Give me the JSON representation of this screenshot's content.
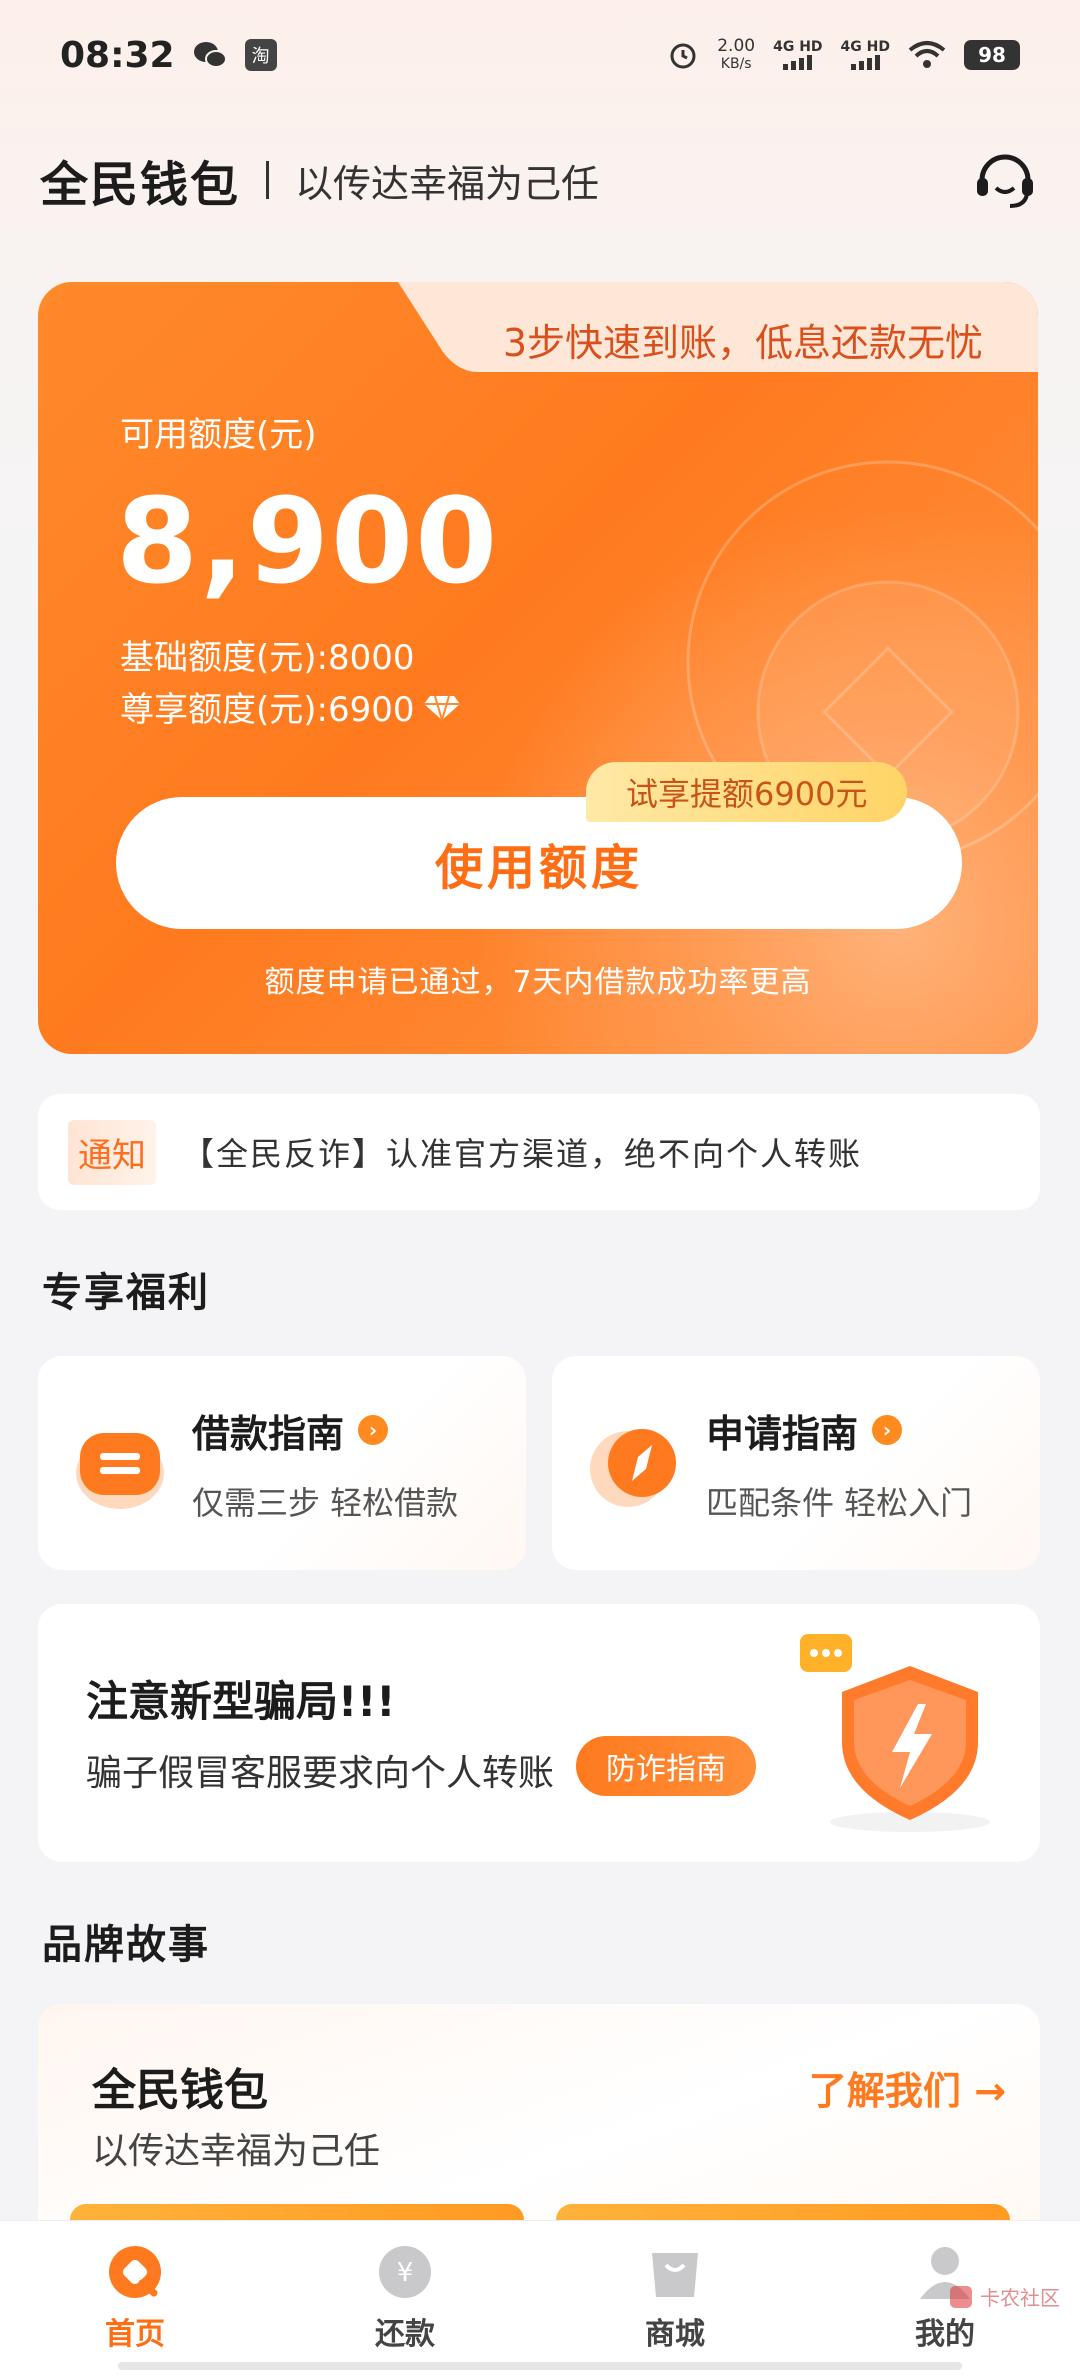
{
  "status_bar": {
    "time": "08:32",
    "app_icon_text": "淘",
    "speed_value": "2.00",
    "speed_unit": "KB/s",
    "net1": "4G HD",
    "net2": "4G HD",
    "battery": "98"
  },
  "header": {
    "brand": "全民钱包",
    "slogan": "以传达幸福为己任",
    "service_icon": "headset-icon"
  },
  "credit_card": {
    "tab_text": "3步快速到账，低息还款无忧",
    "label": "可用额度(元)",
    "amount": "8,900",
    "base_limit": "基础额度(元):8000",
    "vip_limit": "尊享额度(元):6900",
    "promo_badge": "试享提额6900元",
    "use_button": "使用额度",
    "note": "额度申请已通过，7天内借款成功率更高",
    "accent_color": "#ff7a1e"
  },
  "notice": {
    "tag": "通知",
    "text": "【全民反诈】认准官方渠道，绝不向个人转账"
  },
  "benefits": {
    "title": "专享福利",
    "items": [
      {
        "title": "借款指南",
        "subtitle": "仅需三步 轻松借款",
        "icon": "loan-guide-icon"
      },
      {
        "title": "申请指南",
        "subtitle": "匹配条件 轻松入门",
        "icon": "compass-icon"
      }
    ]
  },
  "fraud": {
    "title": "注意新型骗局!!!",
    "desc": "骗子假冒客服要求向个人转账",
    "button": "防诈指南"
  },
  "brand_story": {
    "section_title": "品牌故事",
    "title": "全民钱包",
    "subtitle": "以传达幸福为己任",
    "link": "了解我们 →"
  },
  "tab_bar": {
    "items": [
      {
        "label": "首页",
        "icon": "home-icon",
        "active": true
      },
      {
        "label": "还款",
        "icon": "repay-icon",
        "active": false
      },
      {
        "label": "商城",
        "icon": "shop-bag-icon",
        "active": false
      },
      {
        "label": "我的",
        "icon": "profile-icon",
        "active": false
      }
    ]
  },
  "watermark": "卡农社区"
}
